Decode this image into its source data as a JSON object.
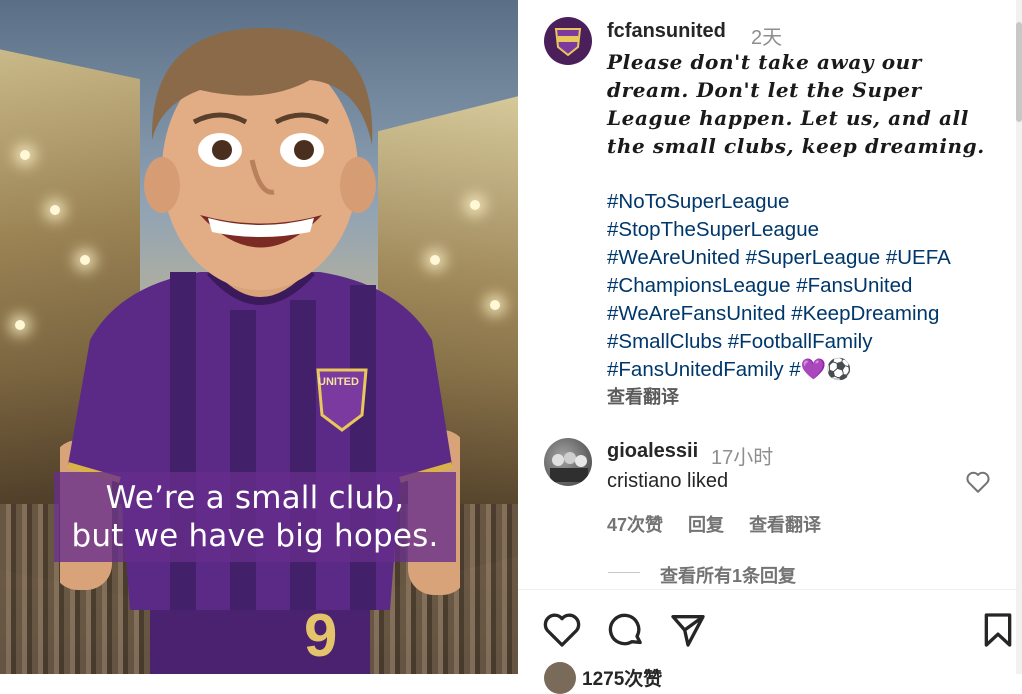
{
  "image": {
    "caption_lines": [
      "We’re a small club,",
      "but we have big hopes."
    ],
    "badge_text": "UNITED",
    "jersey_number": "9"
  },
  "post": {
    "username": "fcfansunited",
    "time": "2天",
    "quote": "Please don't take away our dream. Don't let the Super League happen. Let us, and all the small clubs, keep dreaming.",
    "hashtag_lines": [
      "#NoToSuperLeague",
      "#StopTheSuperLeague",
      "#WeAreUnited #SuperLeague #UEFA",
      "#ChampionsLeague #FansUnited",
      "#WeAreFansUnited #KeepDreaming",
      "#SmallClubs #FootballFamily",
      "#FansUnitedFamily #💜⚽"
    ],
    "translate": "查看翻译"
  },
  "comment": {
    "username": "gioalessii",
    "time": "17小时",
    "text": "cristiano liked",
    "likes": "47次赞",
    "reply": "回复",
    "translate": "查看翻译",
    "view_replies": "查看所有1条回复"
  },
  "actions": {
    "likes_count": "1275次赞"
  },
  "colors": {
    "caption_bg": "#672d8c",
    "hashtag": "#00376b",
    "jersey_purple": "#5b2a86"
  }
}
